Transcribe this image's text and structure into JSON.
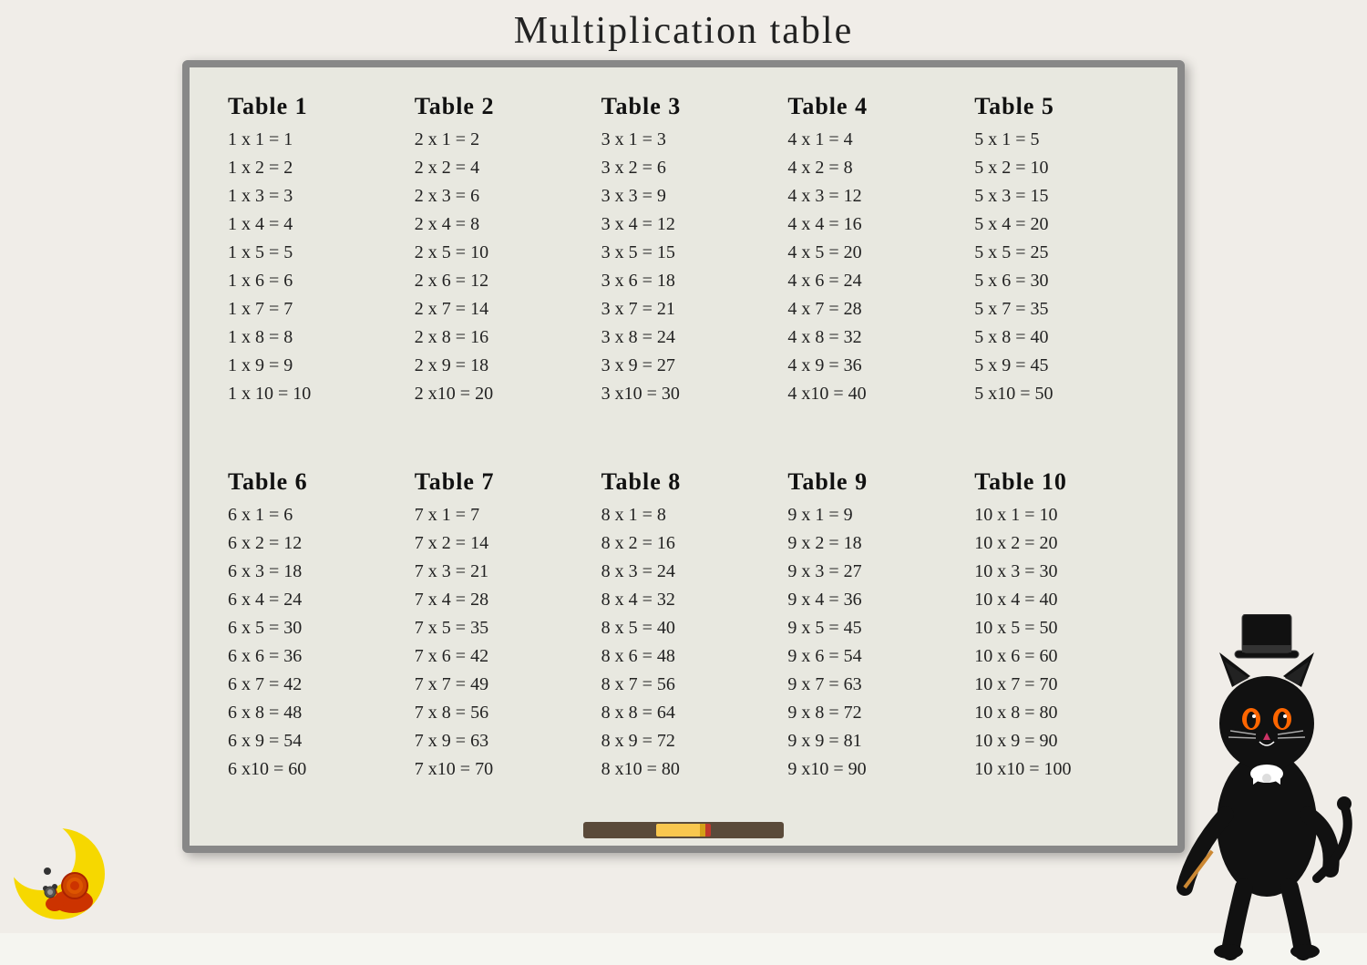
{
  "page": {
    "title": "Multiplication table"
  },
  "tables": [
    {
      "id": 1,
      "title": "Table  1",
      "rows": [
        "1 x  1   = 1",
        "1 x  2   = 2",
        "1 x  3   = 3",
        "1 x  4   = 4",
        "1 x  5   = 5",
        "1 x  6   = 6",
        "1 x  7   = 7",
        "1 x  8   = 8",
        "1 x  9   = 9",
        "1 x  10 = 10"
      ]
    },
    {
      "id": 2,
      "title": "Table  2",
      "rows": [
        "2 x  1 = 2",
        "2 x  2 = 4",
        "2 x  3 = 6",
        "2 x  4 = 8",
        "2 x  5 = 10",
        "2 x  6 = 12",
        "2 x  7 = 14",
        "2 x  8 = 16",
        "2 x  9 = 18",
        "2 x10 = 20"
      ]
    },
    {
      "id": 3,
      "title": "Table  3",
      "rows": [
        "3 x  1 = 3",
        "3 x  2 = 6",
        "3 x  3 = 9",
        "3 x  4 = 12",
        "3 x  5 = 15",
        "3 x  6 = 18",
        "3 x  7 = 21",
        "3 x  8 = 24",
        "3 x  9 = 27",
        "3 x10 = 30"
      ]
    },
    {
      "id": 4,
      "title": "Table  4",
      "rows": [
        "4 x  1 = 4",
        "4 x  2 = 8",
        "4 x  3 = 12",
        "4 x  4 = 16",
        "4 x  5 = 20",
        "4 x  6 = 24",
        "4 x  7 = 28",
        "4 x  8 = 32",
        "4 x  9 = 36",
        "4 x10 = 40"
      ]
    },
    {
      "id": 5,
      "title": "Table  5",
      "rows": [
        "5 x  1 = 5",
        "5 x  2 = 10",
        "5 x  3 = 15",
        "5 x  4 = 20",
        "5 x  5 = 25",
        "5 x  6 = 30",
        "5 x  7 = 35",
        "5 x  8 = 40",
        "5 x  9 = 45",
        "5 x10 = 50"
      ]
    },
    {
      "id": 6,
      "title": "Table  6",
      "rows": [
        "6 x  1 = 6",
        "6 x  2 = 12",
        "6 x  3 = 18",
        "6 x  4 = 24",
        "6 x  5 = 30",
        "6 x  6 = 36",
        "6 x  7 = 42",
        "6 x  8 = 48",
        "6 x  9 = 54",
        "6 x10 = 60"
      ]
    },
    {
      "id": 7,
      "title": "Table  7",
      "rows": [
        "7 x  1 = 7",
        "7 x  2 = 14",
        "7 x  3 = 21",
        "7 x  4 = 28",
        "7 x  5 = 35",
        "7 x  6 = 42",
        "7 x  7 = 49",
        "7 x  8 = 56",
        "7 x  9 = 63",
        "7 x10 = 70"
      ]
    },
    {
      "id": 8,
      "title": "Table  8",
      "rows": [
        "8 x  1 = 8",
        "8 x  2 = 16",
        "8 x  3 = 24",
        "8 x  4 = 32",
        "8 x  5 = 40",
        "8 x  6 = 48",
        "8 x  7 = 56",
        "8 x  8 = 64",
        "8 x  9 = 72",
        "8 x10 = 80"
      ]
    },
    {
      "id": 9,
      "title": "Table  9",
      "rows": [
        "9 x  1 = 9",
        "9 x  2 = 18",
        "9 x  3 = 27",
        "9 x  4 = 36",
        "9 x  5 = 45",
        "9 x  6 = 54",
        "9 x  7 = 63",
        "9 x  8 = 72",
        "9 x  9 = 81",
        "9 x10 = 90"
      ]
    },
    {
      "id": 10,
      "title": "Table  10",
      "rows": [
        "10 x  1 = 10",
        "10 x  2 = 20",
        "10 x  3 = 30",
        "10 x  4 = 40",
        "10 x  5 = 50",
        "10 x  6 = 60",
        "10 x  7 = 70",
        "10 x  8 = 80",
        "10 x  9 = 90",
        "10 x10 = 100"
      ]
    }
  ]
}
